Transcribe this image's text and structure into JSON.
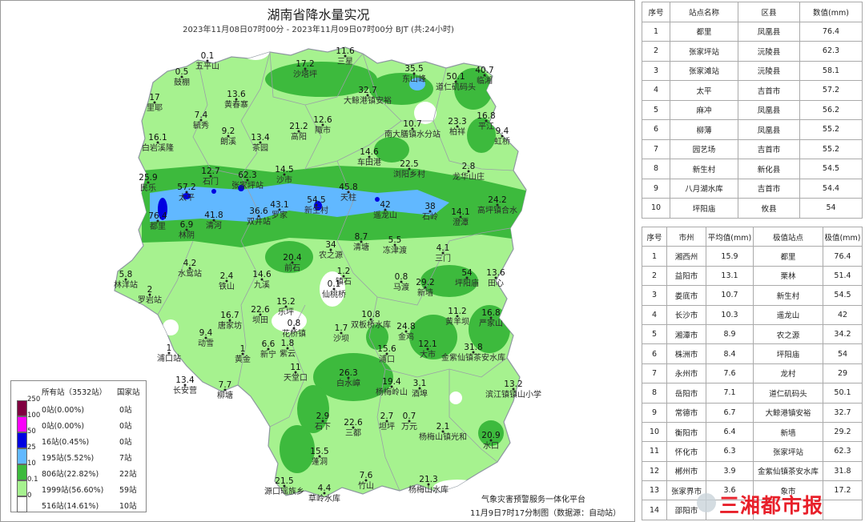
{
  "map": {
    "title": "湖南省降水量实况",
    "subtitle": "2023年11月08日07时00分 - 2023年11月09日07时00分 BJT (共:24小时)",
    "colors": {
      "lt0_1": "#ffffff",
      "r0_1_10": "#a6f28f",
      "r10_25": "#3dba3d",
      "r25_50": "#61b8ff",
      "r50_100": "#0000e1",
      "r100_250": "#fa00fa",
      "r250": "#800040",
      "border": "#9aa0a6"
    },
    "places": [
      {
        "value": "0.1",
        "name": "五平山"
      },
      {
        "value": "0.5",
        "name": "鼓棚"
      },
      {
        "value": "17.2",
        "name": "沙塔坪"
      },
      {
        "value": "11.6",
        "name": "三星"
      },
      {
        "value": "35.5",
        "name": "东山峰"
      },
      {
        "value": "50.1",
        "name": "道仁矶码头"
      },
      {
        "value": "40.7",
        "name": "临湘"
      },
      {
        "value": "17",
        "name": "里耶"
      },
      {
        "value": "13.6",
        "name": "黄春寨"
      },
      {
        "value": "32.7",
        "name": "大鲸港镇安裕"
      },
      {
        "value": "7.4",
        "name": "毓秀"
      },
      {
        "value": "9.2",
        "name": "朗溪"
      },
      {
        "value": "12.6",
        "name": "陬市"
      },
      {
        "value": "10.7",
        "name": "南大膳镇水分站"
      },
      {
        "value": "23.3",
        "name": "柏祥"
      },
      {
        "value": "16.8",
        "name": "平江"
      },
      {
        "value": "9.4",
        "name": "虹桥"
      },
      {
        "value": "16.1",
        "name": "白岩溪隆"
      },
      {
        "value": "13.4",
        "name": "茶园"
      },
      {
        "value": "21.2",
        "name": "高阳"
      },
      {
        "value": "14.6",
        "name": "车田港"
      },
      {
        "value": "22.5",
        "name": "浏阳乡村"
      },
      {
        "value": "2.8",
        "name": "龙华山庄"
      },
      {
        "value": "25.9",
        "name": "民乐"
      },
      {
        "value": "12.7",
        "name": "石门"
      },
      {
        "value": "62.3",
        "name": "张家坪站"
      },
      {
        "value": "14.5",
        "name": "沙市"
      },
      {
        "value": "45.8",
        "name": "天柱"
      },
      {
        "value": "57.2",
        "name": "太平"
      },
      {
        "value": "54.5",
        "name": "新生村"
      },
      {
        "value": "24.2",
        "name": "高坪镇合水"
      },
      {
        "value": "76.4",
        "name": "都里"
      },
      {
        "value": "6.9",
        "name": "林阴"
      },
      {
        "value": "41.8",
        "name": "清河"
      },
      {
        "value": "36.6",
        "name": "双井站"
      },
      {
        "value": "43.1",
        "name": "罗家"
      },
      {
        "value": "42",
        "name": "遥龙山"
      },
      {
        "value": "38",
        "name": "石岭"
      },
      {
        "value": "14.1",
        "name": "澄潭"
      },
      {
        "value": "34",
        "name": "农之源"
      },
      {
        "value": "8.7",
        "name": "清塘"
      },
      {
        "value": "5.5",
        "name": "冻津渡"
      },
      {
        "value": "4.1",
        "name": "三门"
      },
      {
        "value": "20.4",
        "name": "前石"
      },
      {
        "value": "5.8",
        "name": "林洋站"
      },
      {
        "value": "2",
        "name": "罗岩站"
      },
      {
        "value": "4.2",
        "name": "水鸳站"
      },
      {
        "value": "2.4",
        "name": "铁山"
      },
      {
        "value": "14.6",
        "name": "九溪"
      },
      {
        "value": "1.2",
        "name": "镇石"
      },
      {
        "value": "0.8",
        "name": "马渡"
      },
      {
        "value": "29.2",
        "name": "新墙"
      },
      {
        "value": "54",
        "name": "坪阳庙"
      },
      {
        "value": "13.6",
        "name": "田心"
      },
      {
        "value": "0.1",
        "name": "仙桃桥"
      },
      {
        "value": "16.7",
        "name": "唐家坊"
      },
      {
        "value": "22.6",
        "name": "坝田"
      },
      {
        "value": "15.2",
        "name": "乐坪"
      },
      {
        "value": "10.8",
        "name": "双板桥水库"
      },
      {
        "value": "11.2",
        "name": "黄羊坝"
      },
      {
        "value": "16.8",
        "name": "严家山"
      },
      {
        "value": "9.4",
        "name": "动雪"
      },
      {
        "value": "0.8",
        "name": "花桥镇"
      },
      {
        "value": "1.7",
        "name": "沙坝"
      },
      {
        "value": "24.8",
        "name": "金鸡"
      },
      {
        "value": "1",
        "name": "黄金"
      },
      {
        "value": "6.6",
        "name": "新宁"
      },
      {
        "value": "1.8",
        "name": "紫云"
      },
      {
        "value": "15.6",
        "name": "浦口"
      },
      {
        "value": "12.1",
        "name": "大市"
      },
      {
        "value": "31.8",
        "name": "金紫仙镇茶安水库"
      },
      {
        "value": "1",
        "name": "浦口站"
      },
      {
        "value": "11",
        "name": "天堂口"
      },
      {
        "value": "26.3",
        "name": "白水嶂"
      },
      {
        "value": "19.4",
        "name": "杨梅岭山"
      },
      {
        "value": "3.1",
        "name": "酒埠"
      },
      {
        "value": "13.4",
        "name": "长安营"
      },
      {
        "value": "7.7",
        "name": "柳塘"
      },
      {
        "value": "13.2",
        "name": "滨江镇镇山小学"
      },
      {
        "value": "2.9",
        "name": "石下"
      },
      {
        "value": "22.6",
        "name": "三都"
      },
      {
        "value": "2.7",
        "name": "坦坪"
      },
      {
        "value": "0.7",
        "name": "万元"
      },
      {
        "value": "2.1",
        "name": "杨梅山镇光和"
      },
      {
        "value": "20.9",
        "name": "水口"
      },
      {
        "value": "15.5",
        "name": "蓬洞"
      },
      {
        "value": "21.5",
        "name": "源口瑶族乡"
      },
      {
        "value": "4.4",
        "name": "草岭水库"
      },
      {
        "value": "7.6",
        "name": "竹山"
      },
      {
        "value": "21.3",
        "name": "杨梅山水库"
      }
    ]
  },
  "legend": {
    "header_all": "所有站（3532站）",
    "header_nat": "国家站",
    "rows": [
      {
        "color": "#800040",
        "threshold": "250",
        "all": "0站(0.00%)",
        "nat": "0站"
      },
      {
        "color": "#fa00fa",
        "threshold": "100",
        "all": "0站(0.00%)",
        "nat": "0站"
      },
      {
        "color": "#0000e1",
        "threshold": "50",
        "all": "16站(0.45%)",
        "nat": "0站"
      },
      {
        "color": "#61b8ff",
        "threshold": "25",
        "all": "195站(5.52%)",
        "nat": "7站"
      },
      {
        "color": "#3dba3d",
        "threshold": "10",
        "all": "806站(22.82%)",
        "nat": "22站"
      },
      {
        "color": "#a6f28f",
        "threshold": "0.1",
        "all": "1999站(56.60%)",
        "nat": "59站"
      },
      {
        "color": "#ffffff",
        "threshold": "0",
        "all": "516站(14.61%)",
        "nat": "10站"
      }
    ]
  },
  "footer": {
    "platform": "气象灾害预警服务一体化平台",
    "made": "11月9日7时17分制图（数据源：自动站）"
  },
  "watermark": "三湘都市报",
  "stations_table": {
    "headers": [
      "序号",
      "站点名称",
      "区县",
      "数值(mm)"
    ],
    "rows": [
      [
        "1",
        "都里",
        "凤凰县",
        "76.4"
      ],
      [
        "2",
        "张家坪站",
        "沅陵县",
        "62.3"
      ],
      [
        "3",
        "张家滩站",
        "沅陵县",
        "58.1"
      ],
      [
        "4",
        "太平",
        "吉首市",
        "57.2"
      ],
      [
        "5",
        "麻冲",
        "凤凰县",
        "56.2"
      ],
      [
        "6",
        "柳薄",
        "凤凰县",
        "55.2"
      ],
      [
        "7",
        "园艺场",
        "吉首市",
        "55.2"
      ],
      [
        "8",
        "新生村",
        "新化县",
        "54.5"
      ],
      [
        "9",
        "八月湖水库",
        "吉首市",
        "54.4"
      ],
      [
        "10",
        "坪阳庙",
        "攸县",
        "54"
      ]
    ]
  },
  "cities_table": {
    "headers": [
      "序号",
      "市州",
      "平均值(mm)",
      "极值站点",
      "极值(mm)"
    ],
    "rows": [
      [
        "1",
        "湘西州",
        "15.9",
        "都里",
        "76.4"
      ],
      [
        "2",
        "益阳市",
        "13.1",
        "栗林",
        "51.4"
      ],
      [
        "3",
        "娄底市",
        "10.7",
        "新生村",
        "54.5"
      ],
      [
        "4",
        "长沙市",
        "10.3",
        "遥龙山",
        "42"
      ],
      [
        "5",
        "湘潭市",
        "8.9",
        "农之源",
        "34.2"
      ],
      [
        "6",
        "株洲市",
        "8.4",
        "坪阳庙",
        "54"
      ],
      [
        "7",
        "永州市",
        "7.6",
        "龙村",
        "29"
      ],
      [
        "8",
        "岳阳市",
        "7.1",
        "道仁矶码头",
        "50.1"
      ],
      [
        "9",
        "常德市",
        "6.7",
        "大鲸港镇安裕",
        "32.7"
      ],
      [
        "10",
        "衡阳市",
        "6.4",
        "新墙",
        "29.2"
      ],
      [
        "11",
        "怀化市",
        "6.3",
        "张家坪站",
        "62.3"
      ],
      [
        "12",
        "郴州市",
        "3.9",
        "金紫仙镇茶安水库",
        "31.8"
      ],
      [
        "13",
        "张家界市",
        "3.6",
        "象市",
        "17.2"
      ],
      [
        "14",
        "邵阳市",
        "",
        "",
        ""
      ]
    ]
  }
}
